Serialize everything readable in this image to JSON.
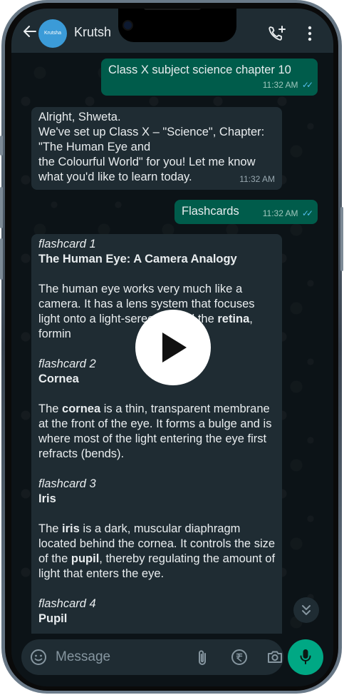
{
  "header": {
    "avatar_text": "Krutsha",
    "contact_name": "Krutsh"
  },
  "messages": {
    "m1": {
      "text": "Class X subject science chapter 10",
      "time": "11:32 AM",
      "ticks": "✓✓"
    },
    "m2": {
      "line1": "Alright, Shweta.",
      "line2": "We've set up Class X – \"Science\", Chapter:",
      "line3": "\"The Human Eye and",
      "line4": "the Colourful World\" for you! Let me know",
      "line5": "what you'd like to learn today.",
      "time": "11:32 AM"
    },
    "m3": {
      "text": "Flashcards",
      "time": "11:32 AM",
      "ticks": "✓✓"
    },
    "flashcards": [
      {
        "label": "flashcard 1",
        "title": "The Human Eye: A Camera Analogy",
        "body_plain": "The human eye works very much like a camera. It has a lens system that focuses light onto a light-se",
        "body_tail": "reen called the ",
        "body_bold": "retina",
        "body_end": ", formin"
      },
      {
        "label": "flashcard 2",
        "title": "Cornea",
        "body_pre": "The ",
        "body_bold": "cornea",
        "body_post": " is a thin, transparent membrane at the front of the eye. It forms a bulge and is where most of the light entering the eye first refracts (bends)."
      },
      {
        "label": "flashcard 3",
        "title": "Iris",
        "body_pre": "The ",
        "body_bold": "iris",
        "body_mid": " is a dark, muscular diaphragm located behind the cornea. It controls the size of the ",
        "body_bold2": "pupil",
        "body_post": ", thereby regulating the amount of light that enters the eye."
      },
      {
        "label": "flashcard 4",
        "title": "Pupil"
      }
    ]
  },
  "composer": {
    "placeholder": "Message"
  },
  "colors": {
    "outgoing_bubble": "#005c4b",
    "incoming_bubble": "#1f2c33",
    "accent": "#00a884",
    "read_ticks": "#53bdeb"
  },
  "icons": [
    "back-arrow-icon",
    "add-call-icon",
    "more-vert-icon",
    "play-icon",
    "chevron-double-down-icon",
    "sticker-icon",
    "attach-icon",
    "rupee-icon",
    "camera-icon",
    "mic-icon"
  ]
}
